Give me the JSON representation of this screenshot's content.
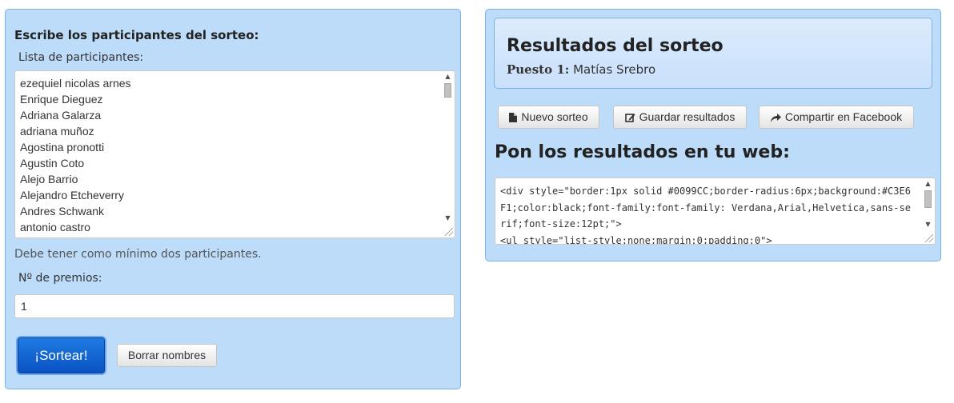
{
  "left": {
    "title": "Escribe los participantes del sorteo:",
    "list_label": "Lista de participantes:",
    "participants": [
      "ezequiel nicolas arnes",
      "Enrique Dieguez",
      "Adriana Galarza",
      "adriana muñoz",
      "Agostina pronotti",
      "Agustin Coto",
      "Alejo Barrio",
      "Alejandro Etcheverry",
      "Andres Schwank",
      "antonio castro"
    ],
    "hint": "Debe tener como mínimo dos participantes.",
    "prizes_label": "Nº de premios:",
    "prizes_value": "1",
    "draw_button": "¡Sortear!",
    "clear_button": "Borrar nombres"
  },
  "right": {
    "results_title": "Resultados del sorteo",
    "result_position_label": "Puesto 1:",
    "result_winner": "Matías Srebro",
    "new_draw_button": "Nuevo sorteo",
    "save_button": "Guardar resultados",
    "share_button": "Compartir en Facebook",
    "embed_title": "Pon los resultados en tu web:",
    "embed_code": "<div style=\"border:1px solid #0099CC;border-radius:6px;background:#C3E6F1;color:black;font-family:font-family: Verdana,Arial,Helvetica,sans-serif;font-size:12pt;\">\n<ul style=\"list-style:none;margin:0;padding:0\">"
  },
  "colors": {
    "panel_background": "#bcdcfa",
    "primary_button": "#0a52c4"
  }
}
